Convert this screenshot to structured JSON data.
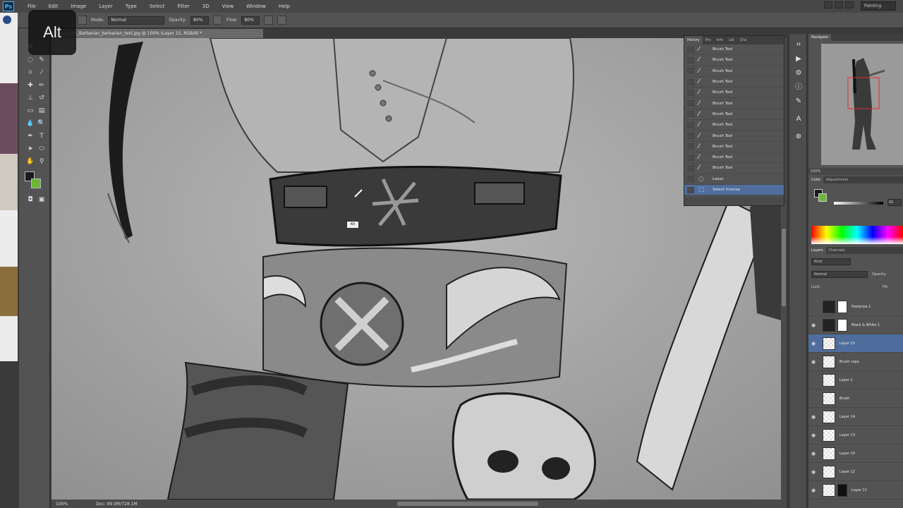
{
  "app": {
    "logo": "Ps",
    "menu": [
      "File",
      "Edit",
      "Image",
      "Layer",
      "Type",
      "Select",
      "Filter",
      "3D",
      "View",
      "Window",
      "Help"
    ],
    "workspace": "Painting"
  },
  "options_bar": {
    "mode_label": "Mode:",
    "mode_value": "Normal",
    "opacity_label": "Opacity:",
    "opacity_value": "80%",
    "flow_label": "Flow:",
    "flow_value": "80%"
  },
  "overlay": {
    "key_label": "Alt"
  },
  "document": {
    "tab_title": "...ocumen_Barbarian_barbarian_test.jpg @ 100% (Layer 15, RGB/8) *",
    "zoom": "100%",
    "doc_size": "Doc: 99.0M/728.1M",
    "cursor_tooltip": "Alt"
  },
  "history": {
    "tabs": [
      "History",
      "Pro",
      "Info",
      "Lib",
      "Cha"
    ],
    "items": [
      {
        "label": "Brush Tool",
        "icon": "brush-icon",
        "selected": false
      },
      {
        "label": "Brush Tool",
        "icon": "brush-icon",
        "selected": false
      },
      {
        "label": "Brush Tool",
        "icon": "brush-icon",
        "selected": false
      },
      {
        "label": "Brush Tool",
        "icon": "brush-icon",
        "selected": false
      },
      {
        "label": "Brush Tool",
        "icon": "brush-icon",
        "selected": false
      },
      {
        "label": "Brush Tool",
        "icon": "brush-icon",
        "selected": false
      },
      {
        "label": "Brush Tool",
        "icon": "brush-icon",
        "selected": false
      },
      {
        "label": "Brush Tool",
        "icon": "brush-icon",
        "selected": false
      },
      {
        "label": "Brush Tool",
        "icon": "brush-icon",
        "selected": false
      },
      {
        "label": "Brush Tool",
        "icon": "brush-icon",
        "selected": false
      },
      {
        "label": "Brush Tool",
        "icon": "brush-icon",
        "selected": false
      },
      {
        "label": "Brush Tool",
        "icon": "brush-icon",
        "selected": false
      },
      {
        "label": "Lasso",
        "icon": "lasso-icon",
        "selected": false
      },
      {
        "label": "Select Inverse",
        "icon": "select-icon",
        "selected": true
      }
    ]
  },
  "navigator": {
    "tabs": [
      "Navigator"
    ],
    "zoom": "100%"
  },
  "color": {
    "tabs": [
      "Color",
      "Adjustments"
    ],
    "value": "60"
  },
  "layers": {
    "tabs": [
      "Layers",
      "Channels"
    ],
    "kind": "Kind",
    "blend_mode": "Normal",
    "opacity_label": "Opacity:",
    "lock_label": "Lock:",
    "fill_label": "Fill:",
    "items": [
      {
        "name": "Posterize 1",
        "visible": false,
        "type": "adjustment",
        "selected": false
      },
      {
        "name": "Black & White 1",
        "visible": true,
        "type": "adjustment",
        "selected": false
      },
      {
        "name": "Layer 15",
        "visible": true,
        "type": "pixel",
        "selected": true
      },
      {
        "name": "Brush copy",
        "visible": true,
        "type": "pixel",
        "selected": false
      },
      {
        "name": "Layer 2",
        "visible": false,
        "type": "pixel",
        "selected": false
      },
      {
        "name": "Brush",
        "visible": false,
        "type": "pixel",
        "selected": false
      },
      {
        "name": "Layer 14",
        "visible": true,
        "type": "pixel",
        "selected": false
      },
      {
        "name": "Layer 13",
        "visible": true,
        "type": "pixel",
        "selected": false
      },
      {
        "name": "Layer 10",
        "visible": true,
        "type": "pixel",
        "selected": false
      },
      {
        "name": "Layer 12",
        "visible": true,
        "type": "pixel",
        "selected": false
      },
      {
        "name": "Layer 11",
        "visible": true,
        "type": "figure",
        "selected": false
      }
    ]
  }
}
